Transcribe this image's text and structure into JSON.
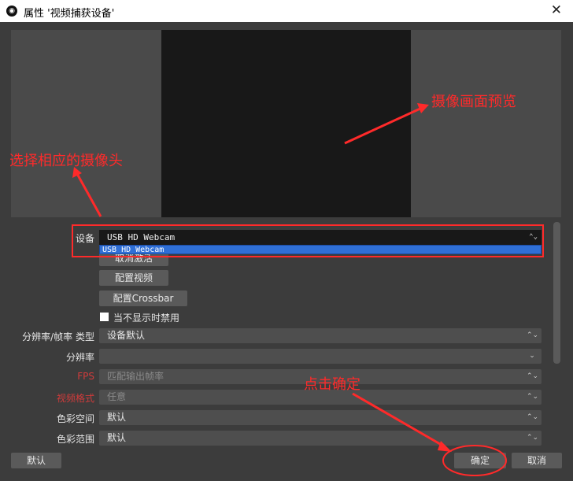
{
  "window": {
    "title": "属性 '视频捕获设备'",
    "close_glyph": "✕"
  },
  "device": {
    "label": "设备",
    "value": "USB HD Webcam",
    "dropdown_option": "USB HD Webcam"
  },
  "buttons": {
    "deactivate": "取消激活",
    "configure_video": "配置视频",
    "configure_crossbar": "配置Crossbar",
    "defaults": "默认",
    "ok": "确定",
    "cancel": "取消"
  },
  "checkbox": {
    "label": "当不显示时禁用",
    "checked": false
  },
  "fields": [
    {
      "label": "分辨率/帧率 类型",
      "value": "设备默认",
      "dim": false,
      "label_red": false
    },
    {
      "label": "分辨率",
      "value": "",
      "dim": false,
      "label_red": false
    },
    {
      "label": "FPS",
      "value": "匹配输出帧率",
      "dim": true,
      "label_red": true
    },
    {
      "label": "视频格式",
      "value": "任意",
      "dim": true,
      "label_red": true
    },
    {
      "label": "色彩空间",
      "value": "默认",
      "dim": false,
      "label_red": false
    },
    {
      "label": "色彩范围",
      "value": "默认",
      "dim": false,
      "label_red": false
    }
  ],
  "annotations": {
    "preview": "摄像画面预览",
    "select_camera": "选择相应的摄像头",
    "click_ok": "点击确定"
  },
  "colors": {
    "annotation": "#ff2a2a",
    "selection": "#2f6fd6"
  }
}
